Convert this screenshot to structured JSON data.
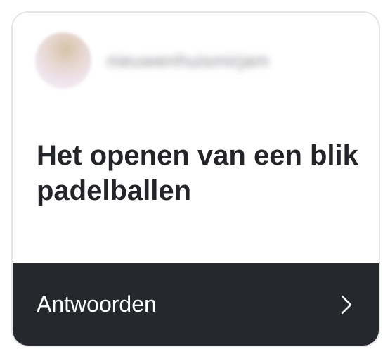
{
  "card": {
    "username": "nieuwenhuismirjam",
    "title": "Het openen van een blik padelballen",
    "reply_label": "Antwoorden"
  }
}
